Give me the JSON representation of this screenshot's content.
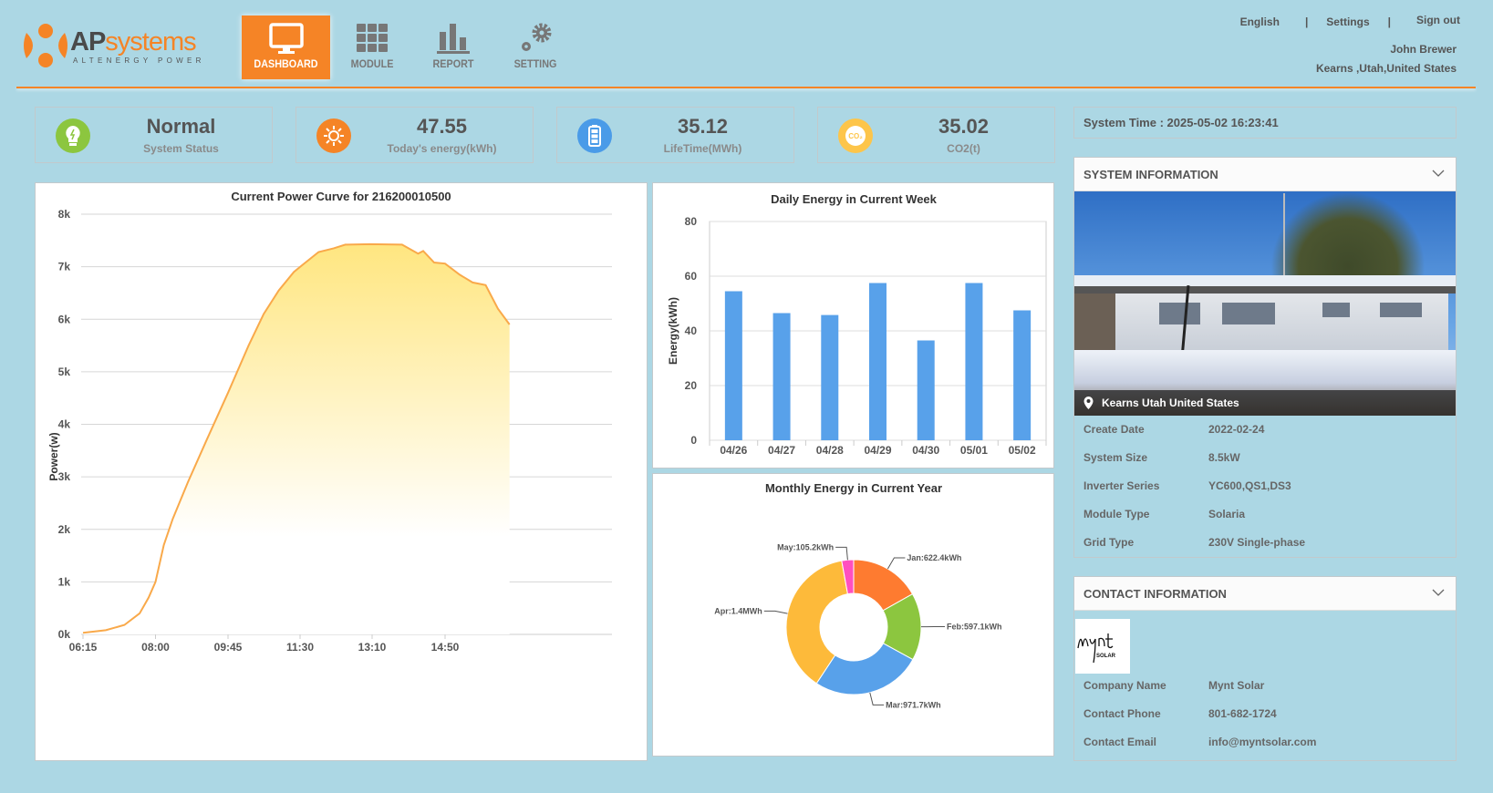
{
  "brand": {
    "name_bold": "AP",
    "name_light": "systems",
    "tagline": "ALTENERGY POWER"
  },
  "nav": [
    {
      "label": "DASHBOARD",
      "icon": "monitor-icon",
      "active": true
    },
    {
      "label": "MODULE",
      "icon": "grid-icon"
    },
    {
      "label": "REPORT",
      "icon": "bar-chart-icon"
    },
    {
      "label": "SETTING",
      "icon": "gear-icon"
    }
  ],
  "top_links": {
    "language": "English",
    "sep": "|",
    "settings": "Settings",
    "signout": "Sign out"
  },
  "user": {
    "name": "John Brewer",
    "location": "Kearns ,Utah,United States"
  },
  "stats": [
    {
      "value": "Normal",
      "caption": "System Status",
      "icon": "bulb-icon",
      "color": "#8cc63f"
    },
    {
      "value": "47.55",
      "caption": "Today's energy(kWh)",
      "icon": "sun-icon",
      "color": "#f58426"
    },
    {
      "value": "35.12",
      "caption": "LifeTime(MWh)",
      "icon": "battery-icon",
      "color": "#4a9be8"
    },
    {
      "value": "35.02",
      "caption": "CO2(t)",
      "icon": "co2-icon",
      "color": "#fdc54a"
    }
  ],
  "system_time": "System Time : 2025-05-02 16:23:41",
  "system_info": {
    "title": "SYSTEM INFORMATION",
    "location": "Kearns Utah United States",
    "rows": [
      {
        "k": "Create Date",
        "v": "2022-02-24"
      },
      {
        "k": "System Size",
        "v": "8.5kW"
      },
      {
        "k": "Inverter Series",
        "v": "YC600,QS1,DS3"
      },
      {
        "k": "Module Type",
        "v": "Solaria"
      },
      {
        "k": "Grid Type",
        "v": "230V Single-phase"
      }
    ]
  },
  "contact_info": {
    "title": "CONTACT INFORMATION",
    "logo_text": "Mynt SOLAR",
    "rows": [
      {
        "k": "Company Name",
        "v": "Mynt Solar"
      },
      {
        "k": "Contact Phone",
        "v": "801-682-1724"
      },
      {
        "k": "Contact Email",
        "v": "info@myntsolar.com"
      }
    ]
  },
  "chart_data": [
    {
      "type": "area",
      "title": "Current Power Curve for 216200010500",
      "ylabel": "Power(w)",
      "ylim": [
        0,
        8000
      ],
      "yticks": [
        "0k",
        "1k",
        "2k",
        "3k",
        "4k",
        "5k",
        "6k",
        "7k",
        "8k"
      ],
      "xticks": [
        "06:15",
        "08:00",
        "09:45",
        "11:30",
        "13:10",
        "14:50"
      ],
      "line_color": "#f9a94a",
      "points": [
        [
          375,
          30
        ],
        [
          408,
          80
        ],
        [
          435,
          180
        ],
        [
          457,
          400
        ],
        [
          470,
          700
        ],
        [
          480,
          1000
        ],
        [
          492,
          1700
        ],
        [
          505,
          2200
        ],
        [
          527,
          2900
        ],
        [
          554,
          3700
        ],
        [
          585,
          4600
        ],
        [
          615,
          5500
        ],
        [
          637,
          6100
        ],
        [
          659,
          6550
        ],
        [
          681,
          6900
        ],
        [
          695,
          7050
        ],
        [
          717,
          7280
        ],
        [
          739,
          7350
        ],
        [
          756,
          7420
        ],
        [
          792,
          7430
        ],
        [
          836,
          7420
        ],
        [
          858,
          7250
        ],
        [
          865,
          7300
        ],
        [
          880,
          7080
        ],
        [
          895,
          7060
        ],
        [
          915,
          6850
        ],
        [
          933,
          6700
        ],
        [
          951,
          6650
        ],
        [
          968,
          6200
        ],
        [
          984,
          5900
        ]
      ]
    },
    {
      "type": "bar",
      "title": "Daily Energy in Current Week",
      "ylabel": "Energy(kWh)",
      "ylim": [
        0,
        80
      ],
      "yticks": [
        "0",
        "20",
        "40",
        "60",
        "80"
      ],
      "categories": [
        "04/26",
        "04/27",
        "04/28",
        "04/29",
        "04/30",
        "05/01",
        "05/02"
      ],
      "values": [
        54.5,
        46.5,
        45.8,
        57.5,
        36.5,
        57.5,
        47.5
      ],
      "color": "#58a1ea"
    },
    {
      "type": "pie",
      "title": "Monthly Energy in Current Year",
      "slices": [
        {
          "label": "Jan:622.4kWh",
          "value": 622.4,
          "color": "#fe7b30"
        },
        {
          "label": "Feb:597.1kWh",
          "value": 597.1,
          "color": "#8cc63f"
        },
        {
          "label": "Mar:971.7kWh",
          "value": 971.7,
          "color": "#58a1ea"
        },
        {
          "label": "Apr:1.4MWh",
          "value": 1400,
          "color": "#fdba3a"
        },
        {
          "label": "May:105.2kWh",
          "value": 105.2,
          "color": "#ff4fbf"
        }
      ]
    }
  ]
}
